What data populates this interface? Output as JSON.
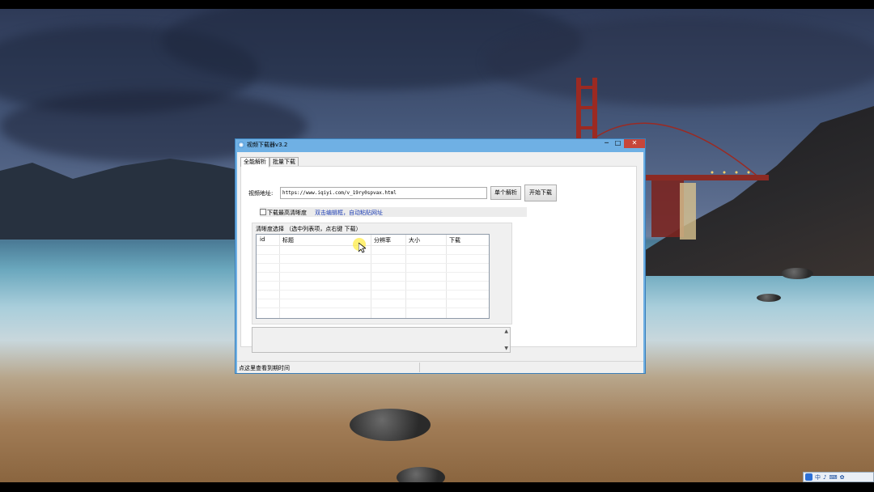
{
  "window": {
    "title": "视频下载器v3.2",
    "controls": {
      "minimize": "─",
      "maximize": "□",
      "close": "✕"
    }
  },
  "tabs": [
    {
      "label": "全能解析",
      "active": true
    },
    {
      "label": "批量下载",
      "active": false
    }
  ],
  "form": {
    "url_label": "视频地址:",
    "url_value": "https://www.iqiyi.com/v_19ry0spvax.html",
    "parse_button": "单个解析",
    "download_button": "开始下载",
    "checkbox_label": "下载最高清晰度",
    "checkbox_checked": false,
    "hint_link": "双击编辑框，自动粘贴网址"
  },
  "quality_group": {
    "title": "清晰度选择 （选中列表项，点右键 下载）",
    "columns": [
      "id",
      "标题",
      "分辨率",
      "大小",
      "下载"
    ],
    "rows": []
  },
  "log_box": {
    "scroll_up": "▲",
    "scroll_down": "▼"
  },
  "statusbar": {
    "text": "点这里查看到期时间"
  },
  "tray": {
    "items": [
      "中",
      "♪",
      "⌨",
      "✿"
    ]
  },
  "colors": {
    "window_frame": "#6fb0e4",
    "close_button": "#c7463a",
    "link": "#1f3fb4"
  }
}
